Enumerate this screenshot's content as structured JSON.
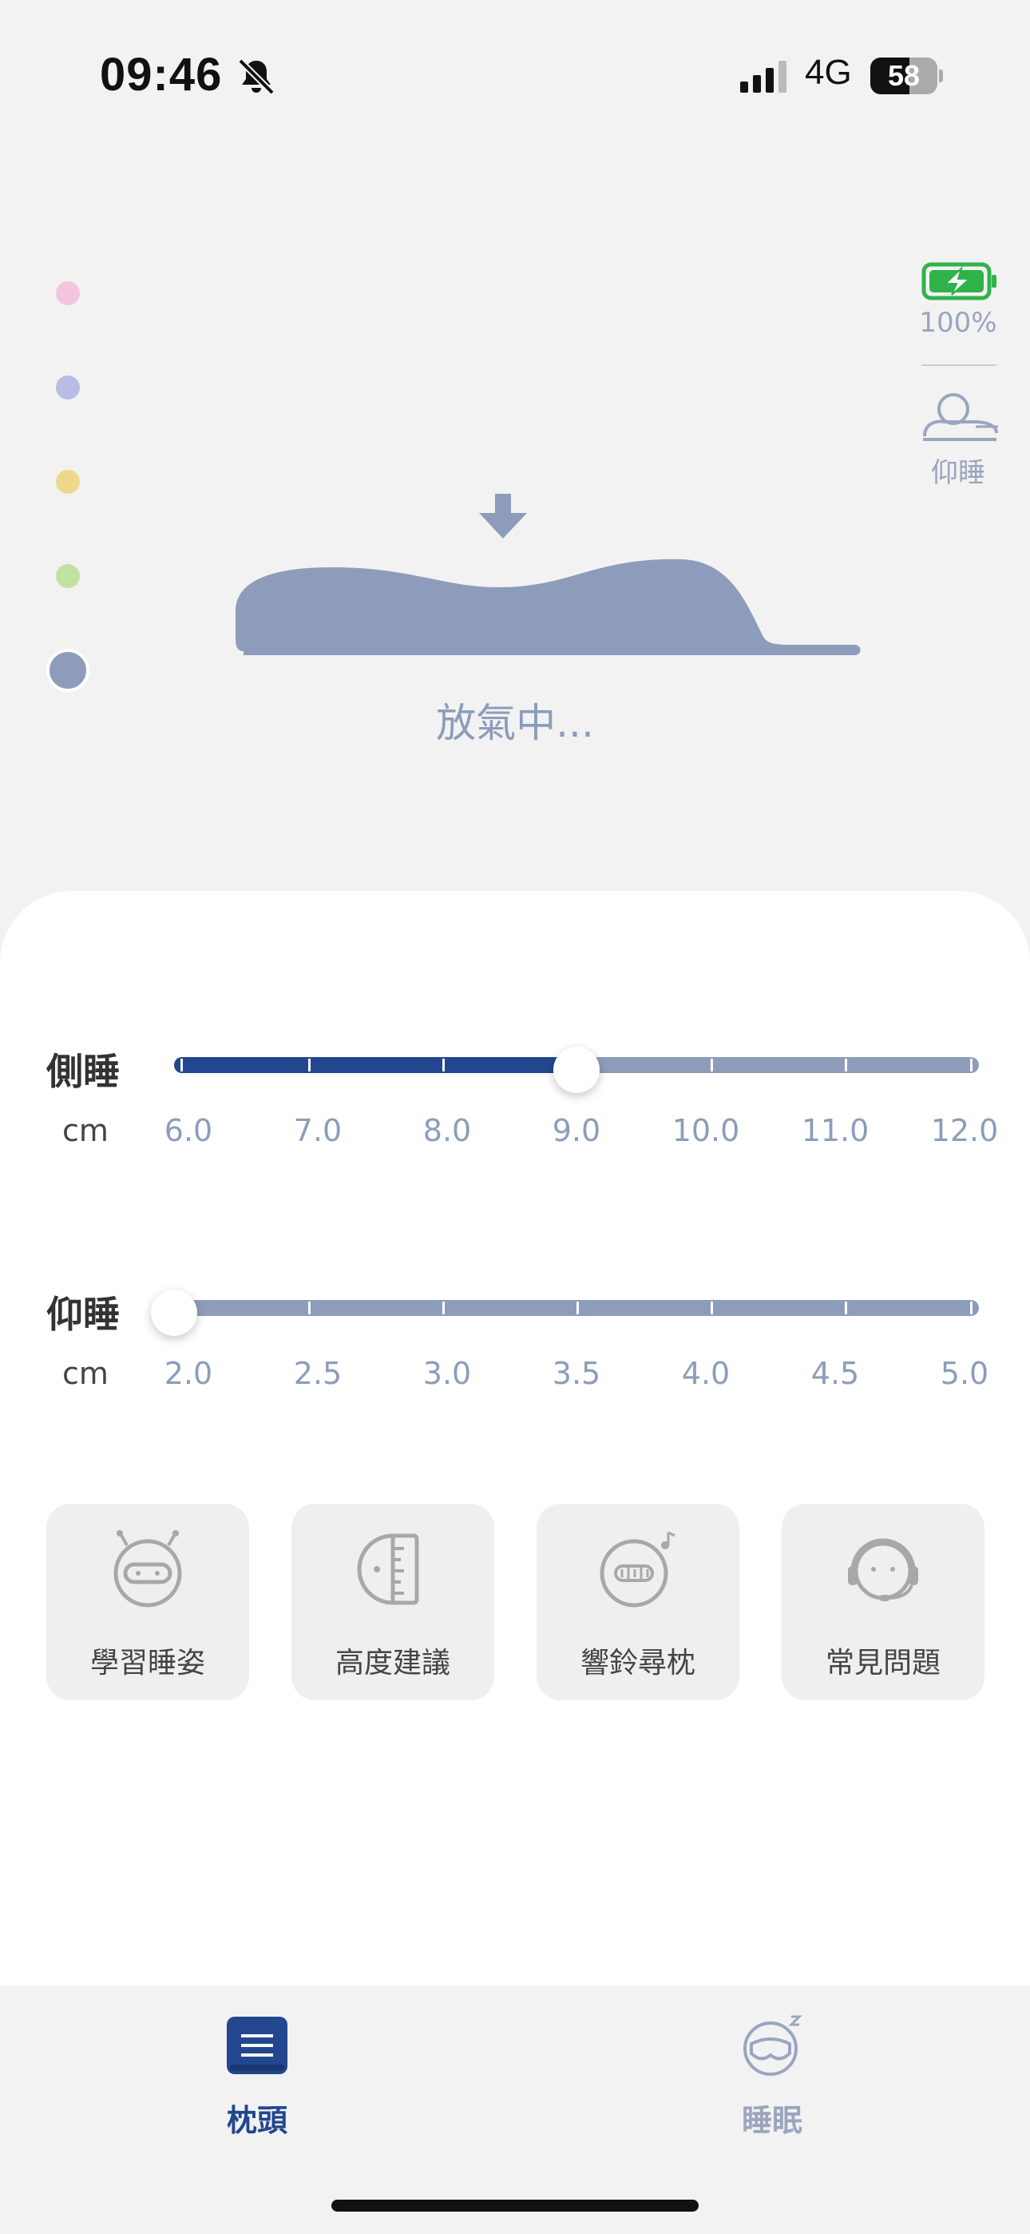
{
  "status_bar": {
    "time": "09:46",
    "network": "4G",
    "battery_level": "58",
    "battery_fraction": 0.58
  },
  "indicator_dots": [
    {
      "color": "#f4c6dd",
      "active": false
    },
    {
      "color": "#b8bde6",
      "active": false
    },
    {
      "color": "#f0d88a",
      "active": false
    },
    {
      "color": "#c2e0a0",
      "active": false
    },
    {
      "color": "#8e9cbc",
      "active": true
    }
  ],
  "pillow": {
    "status_text": "放氣中...",
    "color": "#8e9cbc"
  },
  "device": {
    "battery_text": "100%",
    "posture_label": "仰睡"
  },
  "sliders": [
    {
      "title": "側睡",
      "unit": "cm",
      "ticks": [
        "6.0",
        "7.0",
        "8.0",
        "9.0",
        "10.0",
        "11.0",
        "12.0"
      ],
      "value": 9.0,
      "min": 6.0,
      "max": 12.0
    },
    {
      "title": "仰睡",
      "unit": "cm",
      "ticks": [
        "2.0",
        "2.5",
        "3.0",
        "3.5",
        "4.0",
        "4.5",
        "5.0"
      ],
      "value": 2.0,
      "min": 2.0,
      "max": 5.0
    }
  ],
  "features": [
    {
      "label": "學習睡姿",
      "icon": "robot-icon"
    },
    {
      "label": "高度建議",
      "icon": "ruler-icon"
    },
    {
      "label": "響鈴尋枕",
      "icon": "ring-icon"
    },
    {
      "label": "常見問題",
      "icon": "headset-icon"
    }
  ],
  "tabs": [
    {
      "label": "枕頭",
      "icon": "pillow-tab-icon",
      "active": true
    },
    {
      "label": "睡眠",
      "icon": "sleep-mask-icon",
      "active": false
    }
  ],
  "colors": {
    "accent": "#22478f",
    "slider_track": "#8e9cbc",
    "muted_text": "#8c9dbb",
    "battery_green": "#2fb24a"
  }
}
